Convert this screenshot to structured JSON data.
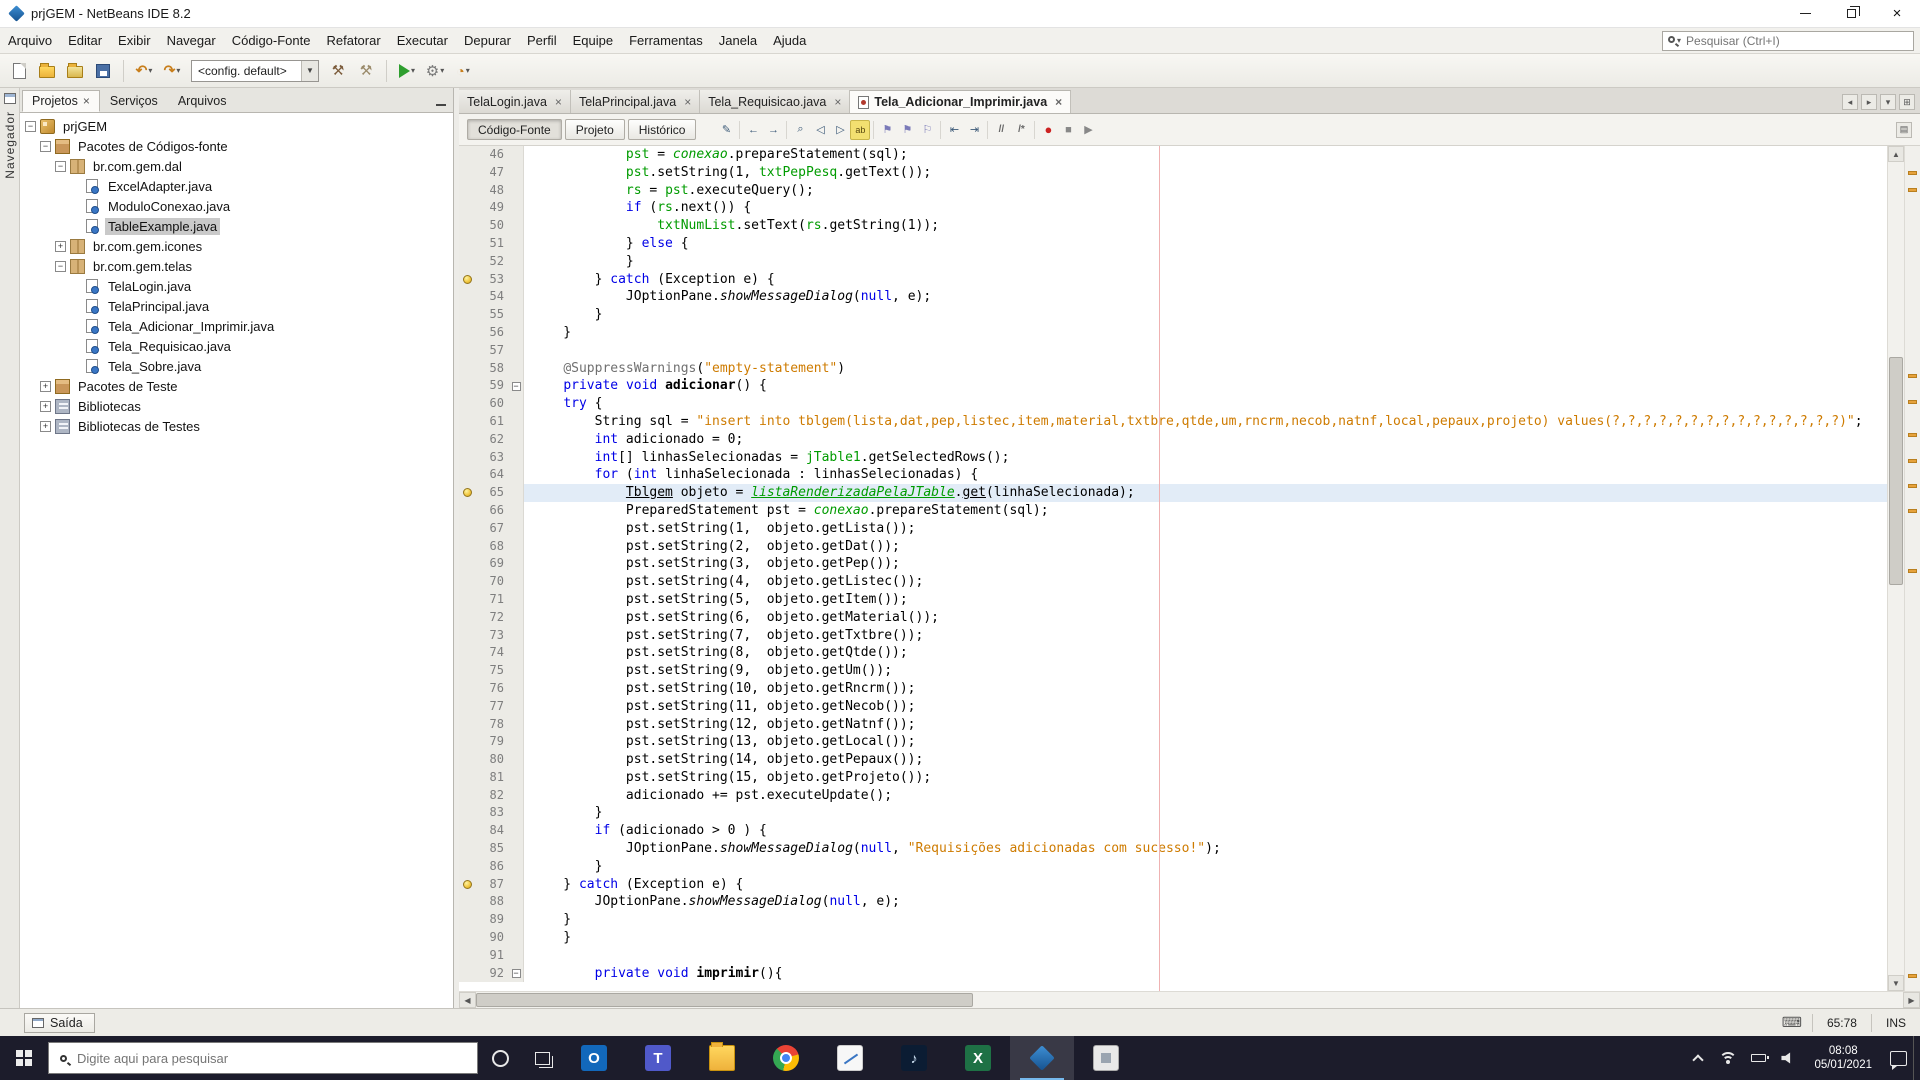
{
  "window": {
    "title": "prjGEM - NetBeans IDE 8.2"
  },
  "menu": {
    "items": [
      "Arquivo",
      "Editar",
      "Exibir",
      "Navegar",
      "Código-Fonte",
      "Refatorar",
      "Executar",
      "Depurar",
      "Perfil",
      "Equipe",
      "Ferramentas",
      "Janela",
      "Ajuda"
    ],
    "search_placeholder": "Pesquisar (Ctrl+I)"
  },
  "toolbar": {
    "config_value": "<config. default>"
  },
  "left_dock": {
    "label": "Navegador"
  },
  "projects_panel": {
    "tabs": [
      {
        "label": "Projetos",
        "active": true
      },
      {
        "label": "Serviços",
        "active": false
      },
      {
        "label": "Arquivos",
        "active": false
      }
    ],
    "tree": [
      {
        "label": "prjGEM",
        "depth": 0,
        "icon": "project",
        "toggle": "minus"
      },
      {
        "label": "Pacotes de Códigos-fonte",
        "depth": 1,
        "icon": "sources",
        "toggle": "minus"
      },
      {
        "label": "br.com.gem.dal",
        "depth": 2,
        "icon": "package",
        "toggle": "minus"
      },
      {
        "label": "ExcelAdapter.java",
        "depth": 3,
        "icon": "java",
        "toggle": "none"
      },
      {
        "label": "ModuloConexao.java",
        "depth": 3,
        "icon": "java",
        "toggle": "none"
      },
      {
        "label": "TableExample.java",
        "depth": 3,
        "icon": "java",
        "toggle": "none",
        "selected": true
      },
      {
        "label": "br.com.gem.icones",
        "depth": 2,
        "icon": "package",
        "toggle": "plus"
      },
      {
        "label": "br.com.gem.telas",
        "depth": 2,
        "icon": "package",
        "toggle": "minus"
      },
      {
        "label": "TelaLogin.java",
        "depth": 3,
        "icon": "java",
        "toggle": "none"
      },
      {
        "label": "TelaPrincipal.java",
        "depth": 3,
        "icon": "java",
        "toggle": "none"
      },
      {
        "label": "Tela_Adicionar_Imprimir.java",
        "depth": 3,
        "icon": "java",
        "toggle": "none"
      },
      {
        "label": "Tela_Requisicao.java",
        "depth": 3,
        "icon": "java",
        "toggle": "none"
      },
      {
        "label": "Tela_Sobre.java",
        "depth": 3,
        "icon": "java",
        "toggle": "none"
      },
      {
        "label": "Pacotes de Teste",
        "depth": 1,
        "icon": "sources",
        "toggle": "plus"
      },
      {
        "label": "Bibliotecas",
        "depth": 1,
        "icon": "libraries",
        "toggle": "plus"
      },
      {
        "label": "Bibliotecas de Testes",
        "depth": 1,
        "icon": "libraries",
        "toggle": "plus"
      }
    ]
  },
  "editor": {
    "tabs": [
      {
        "label": "TelaLogin.java",
        "active": false
      },
      {
        "label": "TelaPrincipal.java",
        "active": false
      },
      {
        "label": "Tela_Requisicao.java",
        "active": false
      },
      {
        "label": "Tela_Adicionar_Imprimir.java",
        "active": true
      }
    ],
    "views": [
      "Código-Fonte",
      "Projeto",
      "Histórico"
    ],
    "active_view": "Código-Fonte",
    "toolbar_icons": [
      "last-edit",
      "back",
      "forward",
      "find-selection",
      "find-previous",
      "find-next",
      "toggle-highlight",
      "previous-bookmark",
      "next-bookmark",
      "toggle-bookmark",
      "shift-left",
      "shift-right",
      "comment",
      "uncomment",
      "record-macro",
      "stop-macro",
      "run-macro"
    ],
    "stripe_marks": [
      3,
      5,
      27,
      30,
      34,
      37,
      40,
      43,
      50,
      98
    ],
    "code": {
      "lines": [
        {
          "n": 46,
          "s": [
            [
              "            ",
              ""
            ],
            [
              "pst",
              "f"
            ],
            [
              " = ",
              ""
            ],
            [
              "conexao",
              "fs"
            ],
            [
              ".prepareStatement(sql);",
              ""
            ]
          ]
        },
        {
          "n": 47,
          "s": [
            [
              "            ",
              ""
            ],
            [
              "pst",
              "f"
            ],
            [
              ".setString(1, ",
              ""
            ],
            [
              "txtPepPesq",
              "f"
            ],
            [
              ".getText());",
              ""
            ]
          ]
        },
        {
          "n": 48,
          "s": [
            [
              "            ",
              ""
            ],
            [
              "rs",
              "f"
            ],
            [
              " = ",
              ""
            ],
            [
              "pst",
              "f"
            ],
            [
              ".executeQuery();",
              ""
            ]
          ]
        },
        {
          "n": 49,
          "s": [
            [
              "            ",
              ""
            ],
            [
              "if",
              "k"
            ],
            [
              " (",
              ""
            ],
            [
              "rs",
              "f"
            ],
            [
              ".next()) {",
              ""
            ]
          ]
        },
        {
          "n": 50,
          "s": [
            [
              "                ",
              ""
            ],
            [
              "txtNumList",
              "f"
            ],
            [
              ".setText(",
              ""
            ],
            [
              "rs",
              "f"
            ],
            [
              ".getString(1));",
              ""
            ]
          ]
        },
        {
          "n": 51,
          "s": [
            [
              "            } ",
              ""
            ],
            [
              "else",
              "k"
            ],
            [
              " {",
              ""
            ]
          ]
        },
        {
          "n": 52,
          "s": [
            [
              "            }",
              ""
            ]
          ]
        },
        {
          "n": 53,
          "w": true,
          "s": [
            [
              "        } ",
              ""
            ],
            [
              "catch",
              "k"
            ],
            [
              " (Exception e) {",
              ""
            ]
          ]
        },
        {
          "n": 54,
          "s": [
            [
              "            JOptionPane.",
              ""
            ],
            [
              "showMessageDialog",
              "sm"
            ],
            [
              "(",
              ""
            ],
            [
              "null",
              "k"
            ],
            [
              ", e);",
              ""
            ]
          ]
        },
        {
          "n": 55,
          "s": [
            [
              "        }",
              ""
            ]
          ]
        },
        {
          "n": 56,
          "s": [
            [
              "    }",
              ""
            ]
          ]
        },
        {
          "n": 57,
          "s": []
        },
        {
          "n": 58,
          "s": [
            [
              "    ",
              ""
            ],
            [
              "@SuppressWarnings",
              "an"
            ],
            [
              "(",
              ""
            ],
            [
              "\"empty-statement\"",
              "s"
            ],
            [
              ")",
              ""
            ]
          ]
        },
        {
          "n": 59,
          "f": true,
          "s": [
            [
              "    ",
              ""
            ],
            [
              "private",
              "k"
            ],
            [
              " ",
              ""
            ],
            [
              "void",
              "k"
            ],
            [
              " ",
              ""
            ],
            [
              "adicionar",
              "md"
            ],
            [
              "() {",
              ""
            ]
          ]
        },
        {
          "n": 60,
          "s": [
            [
              "    ",
              ""
            ],
            [
              "try",
              "k"
            ],
            [
              " {",
              ""
            ]
          ]
        },
        {
          "n": 61,
          "s": [
            [
              "        String sql = ",
              ""
            ],
            [
              "\"insert into tblgem(lista,dat,pep,listec,item,material,txtbre,qtde,um,rncrm,necob,natnf,local,pepaux,projeto) values(?,?,?,?,?,?,?,?,?,?,?,?,?,?,?)\"",
              "s"
            ],
            [
              ";",
              ""
            ]
          ]
        },
        {
          "n": 62,
          "s": [
            [
              "        ",
              ""
            ],
            [
              "int",
              "k"
            ],
            [
              " adicionado = 0;",
              ""
            ]
          ]
        },
        {
          "n": 63,
          "s": [
            [
              "        ",
              ""
            ],
            [
              "int",
              "k"
            ],
            [
              "[] linhasSelecionadas = ",
              ""
            ],
            [
              "jTable1",
              "f"
            ],
            [
              ".getSelectedRows();",
              ""
            ]
          ]
        },
        {
          "n": 64,
          "s": [
            [
              "        ",
              ""
            ],
            [
              "for",
              "k"
            ],
            [
              " (",
              ""
            ],
            [
              "int",
              "k"
            ],
            [
              " linhaSelecionada : linhasSelecionadas) {",
              ""
            ]
          ]
        },
        {
          "n": 65,
          "w": true,
          "c": true,
          "s": [
            [
              "            ",
              ""
            ],
            [
              "Tblgem",
              "ul"
            ],
            [
              " objeto = ",
              ""
            ],
            [
              "listaRenderizadaPelaJTable",
              "fu"
            ],
            [
              ".",
              ""
            ],
            [
              "get",
              "ul"
            ],
            [
              "(linhaSelecionada);",
              ""
            ]
          ]
        },
        {
          "n": 66,
          "s": [
            [
              "            PreparedStatement pst = ",
              ""
            ],
            [
              "conexao",
              "fs"
            ],
            [
              ".prepareStatement(sql);",
              ""
            ]
          ]
        },
        {
          "n": 67,
          "s": [
            [
              "            pst.setString(1,  objeto.getLista());",
              ""
            ]
          ]
        },
        {
          "n": 68,
          "s": [
            [
              "            pst.setString(2,  objeto.getDat());",
              ""
            ]
          ]
        },
        {
          "n": 69,
          "s": [
            [
              "            pst.setString(3,  objeto.getPep());",
              ""
            ]
          ]
        },
        {
          "n": 70,
          "s": [
            [
              "            pst.setString(4,  objeto.getListec());",
              ""
            ]
          ]
        },
        {
          "n": 71,
          "s": [
            [
              "            pst.setString(5,  objeto.getItem());",
              ""
            ]
          ]
        },
        {
          "n": 72,
          "s": [
            [
              "            pst.setString(6,  objeto.getMaterial());",
              ""
            ]
          ]
        },
        {
          "n": 73,
          "s": [
            [
              "            pst.setString(7,  objeto.getTxtbre());",
              ""
            ]
          ]
        },
        {
          "n": 74,
          "s": [
            [
              "            pst.setString(8,  objeto.getQtde());",
              ""
            ]
          ]
        },
        {
          "n": 75,
          "s": [
            [
              "            pst.setString(9,  objeto.getUm());",
              ""
            ]
          ]
        },
        {
          "n": 76,
          "s": [
            [
              "            pst.setString(10, objeto.getRncrm());",
              ""
            ]
          ]
        },
        {
          "n": 77,
          "s": [
            [
              "            pst.setString(11, objeto.getNecob());",
              ""
            ]
          ]
        },
        {
          "n": 78,
          "s": [
            [
              "            pst.setString(12, objeto.getNatnf());",
              ""
            ]
          ]
        },
        {
          "n": 79,
          "s": [
            [
              "            pst.setString(13, objeto.getLocal());",
              ""
            ]
          ]
        },
        {
          "n": 80,
          "s": [
            [
              "            pst.setString(14, objeto.getPepaux());",
              ""
            ]
          ]
        },
        {
          "n": 81,
          "s": [
            [
              "            pst.setString(15, objeto.getProjeto());",
              ""
            ]
          ]
        },
        {
          "n": 82,
          "s": [
            [
              "            adicionado += pst.executeUpdate();",
              ""
            ]
          ]
        },
        {
          "n": 83,
          "s": [
            [
              "        }",
              ""
            ]
          ]
        },
        {
          "n": 84,
          "s": [
            [
              "        ",
              ""
            ],
            [
              "if",
              "k"
            ],
            [
              " (adicionado > 0 ) {",
              ""
            ]
          ]
        },
        {
          "n": 85,
          "s": [
            [
              "            JOptionPane.",
              ""
            ],
            [
              "showMessageDialog",
              "sm"
            ],
            [
              "(",
              ""
            ],
            [
              "null",
              "k"
            ],
            [
              ", ",
              ""
            ],
            [
              "\"Requisições adicionadas com sucesso!\"",
              "s"
            ],
            [
              ");",
              ""
            ]
          ]
        },
        {
          "n": 86,
          "s": [
            [
              "        }",
              ""
            ]
          ]
        },
        {
          "n": 87,
          "w": true,
          "s": [
            [
              "    } ",
              ""
            ],
            [
              "catch",
              "k"
            ],
            [
              " (Exception e) {",
              ""
            ]
          ]
        },
        {
          "n": 88,
          "s": [
            [
              "        JOptionPane.",
              ""
            ],
            [
              "showMessageDialog",
              "sm"
            ],
            [
              "(",
              ""
            ],
            [
              "null",
              "k"
            ],
            [
              ", e);",
              ""
            ]
          ]
        },
        {
          "n": 89,
          "s": [
            [
              "    }",
              ""
            ]
          ]
        },
        {
          "n": 90,
          "s": [
            [
              "    }",
              ""
            ]
          ]
        },
        {
          "n": 91,
          "s": []
        },
        {
          "n": 92,
          "f": true,
          "s": [
            [
              "        ",
              ""
            ],
            [
              "private",
              "k"
            ],
            [
              " ",
              ""
            ],
            [
              "void",
              "k"
            ],
            [
              " ",
              ""
            ],
            [
              "imprimir",
              "md"
            ],
            [
              "(){",
              ""
            ]
          ]
        }
      ]
    }
  },
  "status": {
    "output_label": "Saída",
    "caret_position": "65:78",
    "insert_mode": "INS"
  },
  "taskbar": {
    "search_placeholder": "Digite aqui para pesquisar",
    "apps": [
      {
        "name": "outlook",
        "glyph": "O"
      },
      {
        "name": "teams",
        "glyph": "T"
      },
      {
        "name": "explorer"
      },
      {
        "name": "chrome"
      },
      {
        "name": "notes"
      },
      {
        "name": "spotify",
        "glyph": "♪"
      },
      {
        "name": "excel",
        "glyph": "X"
      },
      {
        "name": "netbeans",
        "active": true
      },
      {
        "name": "paint"
      }
    ],
    "clock_time": "08:08",
    "clock_date": "05/01/2021"
  }
}
